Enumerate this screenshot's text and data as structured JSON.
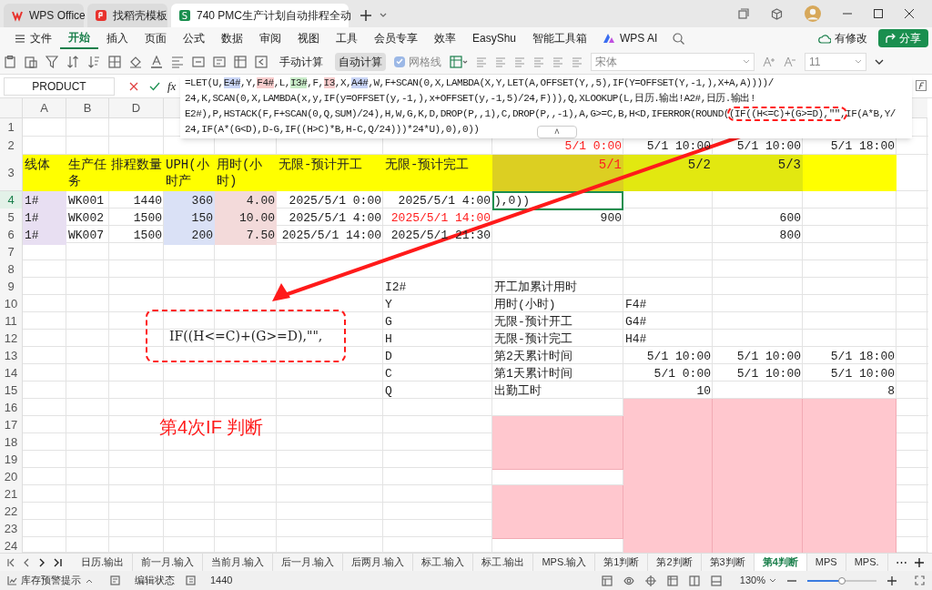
{
  "app_tabs": [
    {
      "label": "WPS Office",
      "selected": false,
      "kind": "wps"
    },
    {
      "label": "找稻壳模板",
      "selected": false,
      "kind": "template"
    },
    {
      "label": "740 PMC生产计划自动排程全动",
      "selected": true,
      "kind": "sheet",
      "logo_text": "S"
    }
  ],
  "menu": [
    {
      "label": "文件",
      "selected": false,
      "kind": "file"
    },
    {
      "label": "开始",
      "selected": true
    },
    {
      "label": "插入",
      "selected": false
    },
    {
      "label": "页面",
      "selected": false
    },
    {
      "label": "公式",
      "selected": false
    },
    {
      "label": "数据",
      "selected": false
    },
    {
      "label": "审阅",
      "selected": false
    },
    {
      "label": "视图",
      "selected": false
    },
    {
      "label": "工具",
      "selected": false
    },
    {
      "label": "会员专享",
      "selected": false
    },
    {
      "label": "效率",
      "selected": false
    },
    {
      "label": "EasyShu",
      "selected": false
    },
    {
      "label": "智能工具箱",
      "selected": false
    },
    {
      "label": "WPS AI",
      "selected": false,
      "kind": "ai"
    }
  ],
  "modified": "有修改",
  "share": "分享",
  "toolbar": {
    "manual_calc": {
      "label": "手动计算",
      "selected": false
    },
    "auto_calc": {
      "label": "自动计算",
      "selected": true
    },
    "gridlines": {
      "label": "网格线",
      "checked": true
    },
    "font": "宋体",
    "font_size": "11"
  },
  "name_box": "PRODUCT",
  "fx_label": "fx",
  "collapse_glyph": "˄",
  "more_glyph": "⋯",
  "formula_lines": [
    [
      {
        "text": "=LET(U,"
      },
      {
        "text": "E4#",
        "color": "#c9d5f7"
      },
      {
        "text": ",Y,"
      },
      {
        "text": "F4#",
        "color": "#f7cccc"
      },
      {
        "text": ",L,"
      },
      {
        "text": "I3#",
        "color": "#c9ecc9"
      },
      {
        "text": ",F,"
      },
      {
        "text": "I3",
        "color": "#f7cccc"
      },
      {
        "text": ",X,"
      },
      {
        "text": "A4#",
        "color": "#c9d5f7"
      },
      {
        "text": ",W,F+SCAN(0,X,LAMBDA(X,Y,LET(A,OFFSET(Y,,5),IF(Y=OFFSET(Y,-1,),X+A,A))))/"
      }
    ],
    [
      {
        "text": "24,K,SCAN(0,X,LAMBDA(x,y,IF(y=OFFSET(y,-1,),x+OFFSET(y,-1,5)/24,F))),Q,XLOOKUP(L,日历.输出!A2#,日历.输出!"
      }
    ],
    [
      {
        "text": "E2#),P,HSTACK(F,F+SCAN(0,Q,SUM)/24),H,W,G,K,D,DROP(P,,1),C,DROP(P,,-1),A,G>=C,B,H<D,IFERROR(ROUND("
      },
      {
        "text": "(IF((H<=C)+(G>=D),\"\",",
        "boxed": true
      },
      {
        "text": "IF(A*B,Y/"
      }
    ],
    [
      {
        "text": "24,IF(A*(G<D),D-G,IF((H>C)*B,H-C,Q/24)))*24*U),0),0))"
      }
    ]
  ],
  "columns": [
    "A",
    "B",
    "D"
  ],
  "rows": [
    {
      "number": "1",
      "selected": false,
      "cells": {}
    },
    {
      "number": "2",
      "selected": false,
      "cells": {
        "I": {
          "text": "5/1 0:00",
          "flagged": true
        },
        "J": "5/1 10:00",
        "K": "5/1 10:00",
        "L": "5/1 18:00"
      }
    },
    {
      "number": "3",
      "selected": false,
      "cells": {
        "A": "线体",
        "B": "生产任务",
        "D": "排程数量",
        "E": "UPH(小时产",
        "F": "用时(小时)",
        "G": "无限-预计开工",
        "H": "无限-预计完工",
        "I": {
          "text": "5/1",
          "flagged": true
        },
        "J": "5/2",
        "K": "5/3"
      }
    },
    {
      "number": "4",
      "selected": true,
      "cells": {
        "A": "1#",
        "B": "WK001",
        "D": "1440",
        "E": "360",
        "F": "4.00",
        "G": "2025/5/1 0:00",
        "H": "2025/5/1 4:00",
        "I": "),0))"
      }
    },
    {
      "number": "5",
      "selected": false,
      "cells": {
        "A": "1#",
        "B": "WK002",
        "D": "1500",
        "E": "150",
        "F": "10.00",
        "G": "2025/5/1 4:00",
        "H": {
          "text": "2025/5/1 14:00",
          "flagged": true
        },
        "I": "900",
        "K": "600"
      }
    },
    {
      "number": "6",
      "selected": false,
      "cells": {
        "A": "1#",
        "B": "WK007",
        "D": "1500",
        "E": "200",
        "F": "7.50",
        "G": "2025/5/1 14:00",
        "H": "2025/5/1 21:30",
        "K": "800"
      }
    },
    {
      "number": "7",
      "selected": false,
      "cells": {}
    },
    {
      "number": "8",
      "selected": false,
      "cells": {}
    },
    {
      "number": "9",
      "selected": false,
      "cells": {
        "H": "I2#",
        "I": "开工加累计用时"
      }
    },
    {
      "number": "10",
      "selected": false,
      "cells": {
        "H": "Y",
        "I": "用时(小时)",
        "J": "F4#"
      }
    },
    {
      "number": "11",
      "selected": false,
      "cells": {
        "H": "G",
        "I": "无限-预计开工",
        "J": "G4#"
      }
    },
    {
      "number": "12",
      "selected": false,
      "cells": {
        "H": "H",
        "I": "无限-预计完工",
        "J": "H4#"
      }
    },
    {
      "number": "13",
      "selected": false,
      "cells": {
        "H": "D",
        "I": "第2天累计时间",
        "J": "5/1 10:00",
        "K": "5/1 10:00",
        "L": "5/1 18:00"
      }
    },
    {
      "number": "14",
      "selected": false,
      "cells": {
        "H": "C",
        "I": "第1天累计时间",
        "J": "5/1 0:00",
        "K": "5/1 10:00",
        "L": "5/1 10:00"
      }
    },
    {
      "number": "15",
      "selected": false,
      "cells": {
        "H": "Q",
        "I": "出勤工时",
        "J": "10",
        "L": "8"
      }
    },
    {
      "number": "16",
      "selected": false,
      "cells": {}
    },
    {
      "number": "17",
      "selected": false,
      "cells": {}
    },
    {
      "number": "18",
      "selected": false,
      "cells": {}
    },
    {
      "number": "19",
      "selected": false,
      "cells": {}
    },
    {
      "number": "20",
      "selected": false,
      "cells": {}
    },
    {
      "number": "21",
      "selected": false,
      "cells": {}
    },
    {
      "number": "22",
      "selected": false,
      "cells": {}
    },
    {
      "number": "23",
      "selected": false,
      "cells": {}
    },
    {
      "number": "24",
      "selected": false,
      "cells": {}
    }
  ],
  "annotation": {
    "callout": "IF((H<=C)+(G>=D),\"\",",
    "label": "第4次IF 判断"
  },
  "sheet_tabs": [
    {
      "label": "日历.输出",
      "selected": false
    },
    {
      "label": "前一月.输入",
      "selected": false
    },
    {
      "label": "当前月.输入",
      "selected": false
    },
    {
      "label": "后一月.输入",
      "selected": false
    },
    {
      "label": "后两月.输入",
      "selected": false
    },
    {
      "label": "标工.输入",
      "selected": false
    },
    {
      "label": "标工.输出",
      "selected": false
    },
    {
      "label": "MPS.输入",
      "selected": false
    },
    {
      "label": "第1判断",
      "selected": false
    },
    {
      "label": "第2判断",
      "selected": false
    },
    {
      "label": "第3判断",
      "selected": false
    },
    {
      "label": "第4判断",
      "selected": true
    },
    {
      "label": "MPS",
      "selected": false
    },
    {
      "label": "MPS.",
      "selected": false
    }
  ],
  "status": {
    "alert": "库存预警提示",
    "mode": "编辑状态",
    "value": "1440",
    "zoom": "130%",
    "zoom_level": {
      "level": 0.5
    }
  }
}
